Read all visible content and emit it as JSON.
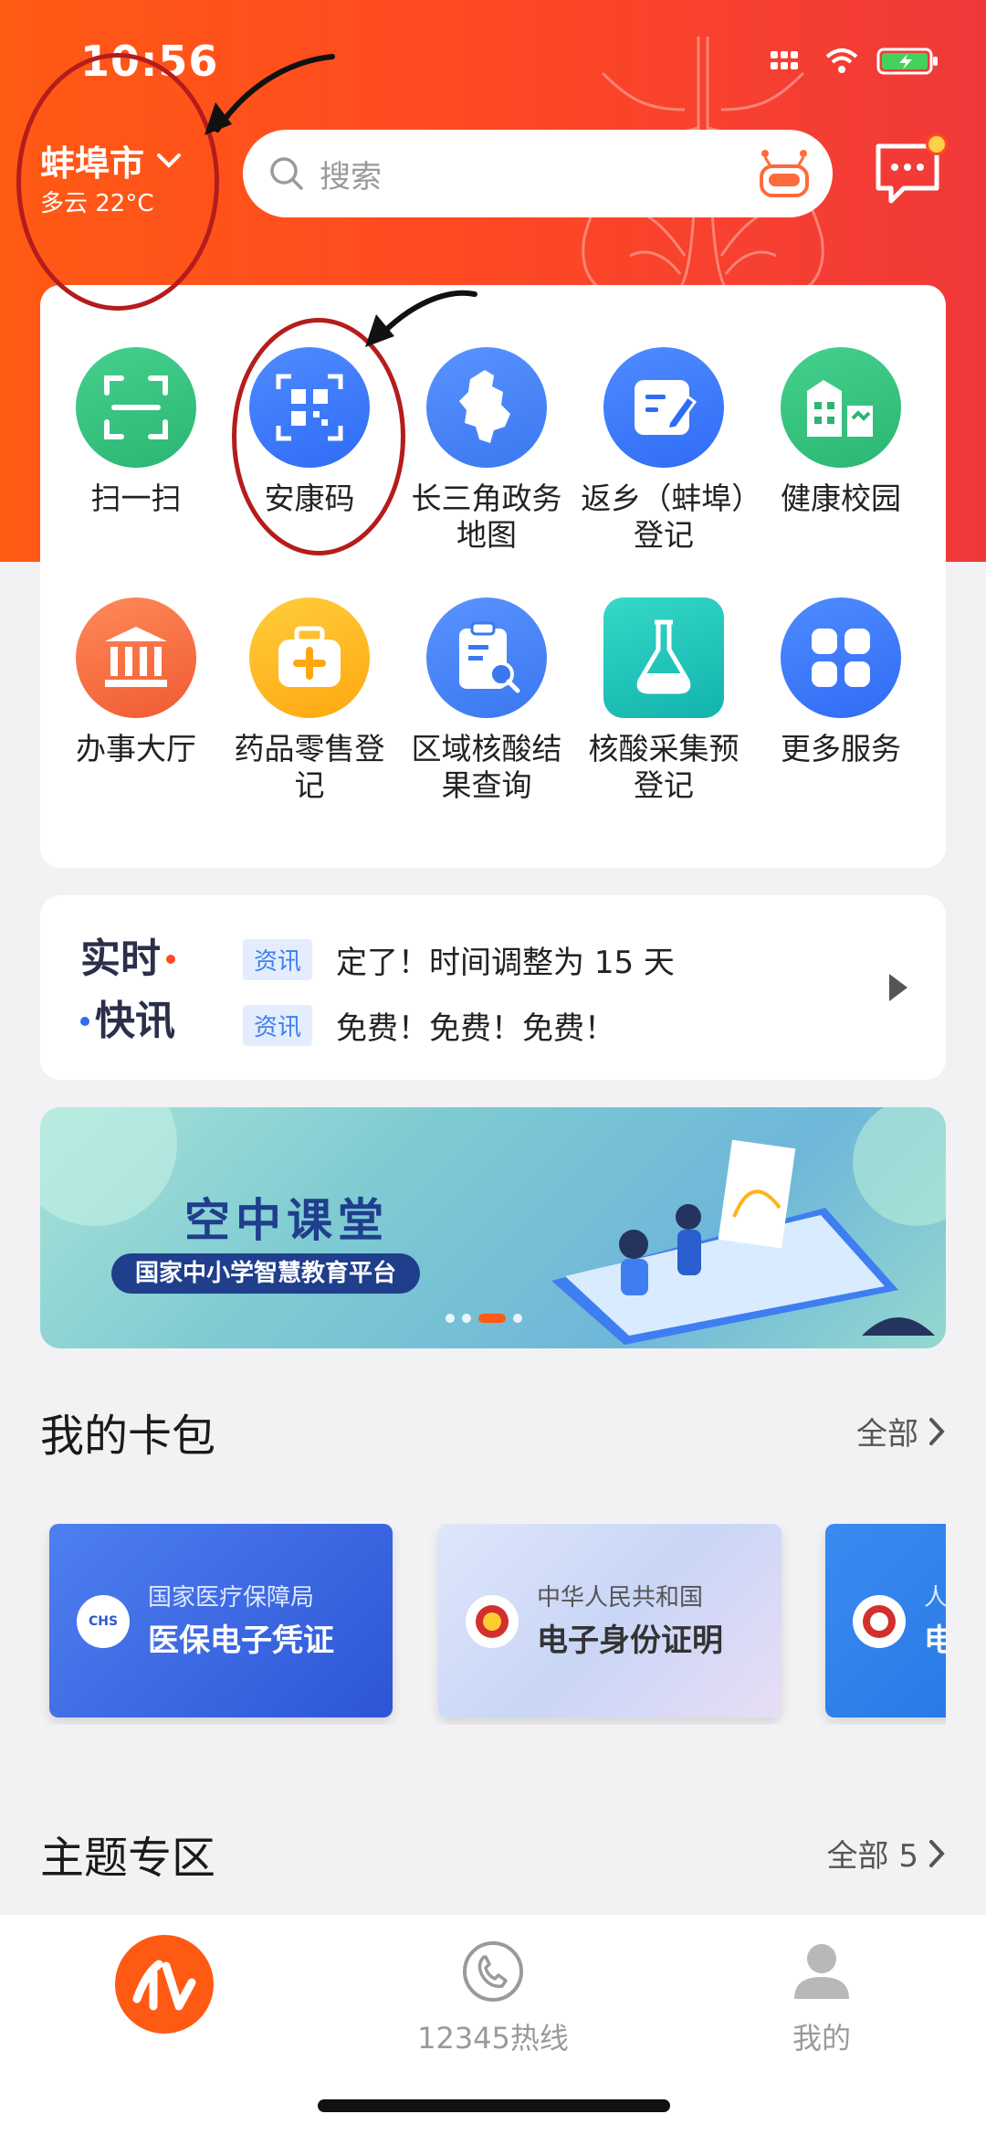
{
  "status_bar": {
    "time": "10:56"
  },
  "header": {
    "city": "蚌埠市",
    "weather": "多云 22°C",
    "search_placeholder": "搜索"
  },
  "services": [
    {
      "label": "扫一扫",
      "icon": "scan-icon",
      "color": "#2bb673"
    },
    {
      "label": "安康码",
      "icon": "qr-code-icon",
      "color": "#2f6cf5"
    },
    {
      "label": "长三角政务地图",
      "icon": "map-icon",
      "color": "#3a78f0"
    },
    {
      "label": "返乡（蚌埠）登记",
      "icon": "edit-form-icon",
      "color": "#2f6cf5"
    },
    {
      "label": "健康校园",
      "icon": "school-health-icon",
      "color": "#2bb673"
    },
    {
      "label": "办事大厅",
      "icon": "hall-icon",
      "color": "#ff6a3c"
    },
    {
      "label": "药品零售登记",
      "icon": "medicine-box-icon",
      "color": "#ffb319"
    },
    {
      "label": "区域核酸结果查询",
      "icon": "clipboard-search-icon",
      "color": "#3a78f0"
    },
    {
      "label": "核酸采集预登记",
      "icon": "flask-icon",
      "color": "#16c2b8"
    },
    {
      "label": "更多服务",
      "icon": "grid-icon",
      "color": "#2f6cf5"
    }
  ],
  "news": {
    "brand_line1": "实时",
    "brand_line2": "快讯",
    "items": [
      {
        "tag": "资讯",
        "text": "定了！时间调整为 15 天"
      },
      {
        "tag": "资讯",
        "text": "免费！免费！免费！"
      }
    ]
  },
  "banner": {
    "title": "空中课堂",
    "subtitle": "国家中小学智慧教育平台"
  },
  "card_wallet": {
    "title": "我的卡包",
    "more": "全部",
    "cards": [
      {
        "org": "国家医疗保障局",
        "name": "医保电子凭证",
        "logo_text": "CHS"
      },
      {
        "org": "中华人民共和国",
        "name": "电子身份证明"
      },
      {
        "org": "人",
        "name": "电"
      }
    ]
  },
  "theme_zone": {
    "title": "主题专区",
    "more": "全部 5"
  },
  "tabbar": {
    "tabs": [
      {
        "label": "",
        "icon": "home-logo-icon"
      },
      {
        "label": "12345热线",
        "icon": "hotline-phone-icon"
      },
      {
        "label": "我的",
        "icon": "profile-icon"
      }
    ]
  },
  "colors": {
    "brand_orange": "#ff5a14",
    "accent_red": "#f0383a",
    "annotation_red": "#b51c1c"
  }
}
